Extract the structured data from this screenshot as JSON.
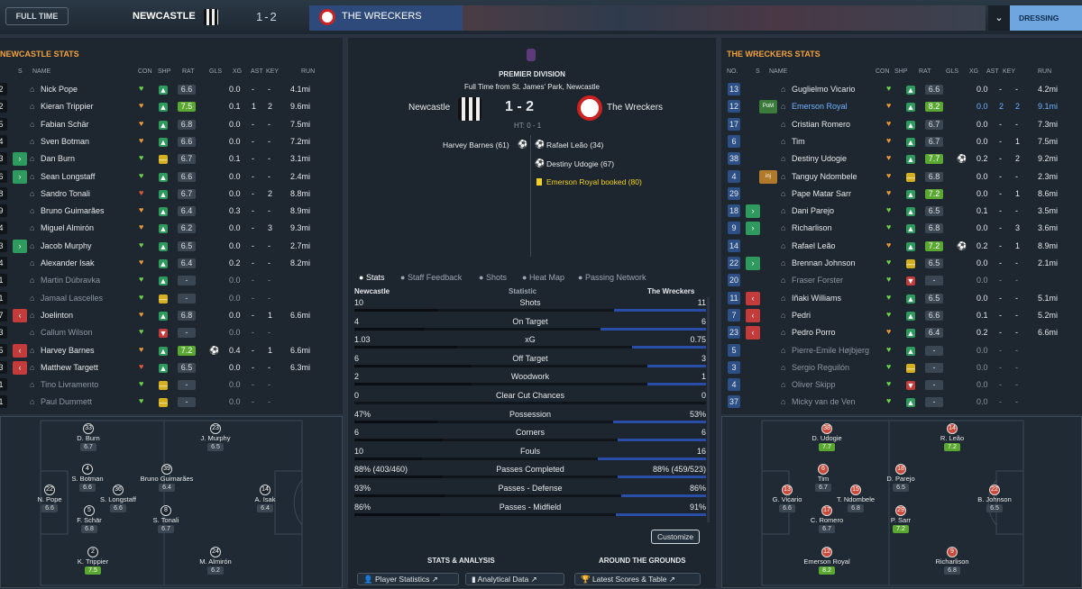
{
  "header": {
    "status": "FULL TIME",
    "home": "NEWCASTLE",
    "score": "1-2",
    "away": "THE WRECKERS",
    "dressing": "DRESSING ROOM"
  },
  "home_stats": {
    "title": "NEWCASTLE STATS",
    "cols": [
      "S",
      "NAME",
      "CON",
      "SHP",
      "RAT",
      "GLS",
      "XG",
      "AST",
      "KEY",
      "RUN"
    ],
    "rows": [
      {
        "no": "2",
        "name": "Nick Pope",
        "con": "g",
        "shp": "g",
        "rat": "6.6",
        "gls": "",
        "xg": "0.0",
        "ast": "-",
        "key": "-",
        "run": "4.1mi",
        "sub": ""
      },
      {
        "no": "2",
        "name": "Kieran Trippier",
        "con": "o",
        "shp": "g",
        "rat": "7.5",
        "gls": "",
        "xg": "0.1",
        "ast": "1",
        "key": "2",
        "run": "9.6mi",
        "sub": "",
        "hi": true
      },
      {
        "no": "5",
        "name": "Fabian Schär",
        "con": "o",
        "shp": "g",
        "rat": "6.8",
        "gls": "",
        "xg": "0.0",
        "ast": "-",
        "key": "-",
        "run": "7.5mi",
        "sub": ""
      },
      {
        "no": "4",
        "name": "Sven Botman",
        "con": "o",
        "shp": "g",
        "rat": "6.6",
        "gls": "",
        "xg": "0.0",
        "ast": "-",
        "key": "-",
        "run": "7.2mi",
        "sub": ""
      },
      {
        "no": "3",
        "name": "Dan Burn",
        "con": "g",
        "shp": "y",
        "rat": "6.7",
        "gls": "",
        "xg": "0.1",
        "ast": "-",
        "key": "-",
        "run": "3.1mi",
        "sub": "in"
      },
      {
        "no": "6",
        "name": "Sean Longstaff",
        "con": "g",
        "shp": "g",
        "rat": "6.6",
        "gls": "",
        "xg": "0.0",
        "ast": "-",
        "key": "-",
        "run": "2.4mi",
        "sub": "in"
      },
      {
        "no": "8",
        "name": "Sandro Tonali",
        "con": "r",
        "shp": "g",
        "rat": "6.7",
        "gls": "",
        "xg": "0.0",
        "ast": "-",
        "key": "2",
        "run": "8.8mi",
        "sub": ""
      },
      {
        "no": "9",
        "name": "Bruno Guimarães",
        "con": "o",
        "shp": "g",
        "rat": "6.4",
        "gls": "",
        "xg": "0.3",
        "ast": "-",
        "key": "-",
        "run": "8.9mi",
        "sub": ""
      },
      {
        "no": "4",
        "name": "Miguel Almirón",
        "con": "o",
        "shp": "g",
        "rat": "6.2",
        "gls": "",
        "xg": "0.0",
        "ast": "-",
        "key": "3",
        "run": "9.3mi",
        "sub": ""
      },
      {
        "no": "3",
        "name": "Jacob Murphy",
        "con": "g",
        "shp": "g",
        "rat": "6.5",
        "gls": "",
        "xg": "0.0",
        "ast": "-",
        "key": "-",
        "run": "2.7mi",
        "sub": "in"
      },
      {
        "no": "4",
        "name": "Alexander Isak",
        "con": "o",
        "shp": "g",
        "rat": "6.4",
        "gls": "",
        "xg": "0.2",
        "ast": "-",
        "key": "-",
        "run": "8.2mi",
        "sub": ""
      },
      {
        "no": "1",
        "name": "Martin Dúbravka",
        "con": "g",
        "shp": "g",
        "rat": "-",
        "gls": "",
        "xg": "0.0",
        "ast": "-",
        "key": "-",
        "run": "",
        "sub": "",
        "dim": true
      },
      {
        "no": "1",
        "name": "Jamaal Lascelles",
        "con": "g",
        "shp": "y",
        "rat": "-",
        "gls": "",
        "xg": "0.0",
        "ast": "-",
        "key": "-",
        "run": "",
        "sub": "",
        "dim": true
      },
      {
        "no": "7",
        "name": "Joelinton",
        "con": "o",
        "shp": "g",
        "rat": "6.8",
        "gls": "",
        "xg": "0.0",
        "ast": "-",
        "key": "1",
        "run": "6.6mi",
        "sub": "out"
      },
      {
        "no": "3",
        "name": "Callum Wilson",
        "con": "g",
        "shp": "r",
        "rat": "-",
        "gls": "",
        "xg": "0.0",
        "ast": "-",
        "key": "-",
        "run": "",
        "sub": "",
        "dim": true
      },
      {
        "no": "5",
        "name": "Harvey Barnes",
        "con": "o",
        "shp": "g",
        "rat": "7.2",
        "gls": "⚽",
        "xg": "0.4",
        "ast": "-",
        "key": "1",
        "run": "6.6mi",
        "sub": "out",
        "hi": true
      },
      {
        "no": "3",
        "name": "Matthew Targett",
        "con": "r",
        "shp": "g",
        "rat": "6.5",
        "gls": "",
        "xg": "0.0",
        "ast": "-",
        "key": "-",
        "run": "6.3mi",
        "sub": "out"
      },
      {
        "no": "1",
        "name": "Tino Livramento",
        "con": "g",
        "shp": "y",
        "rat": "-",
        "gls": "",
        "xg": "0.0",
        "ast": "-",
        "key": "-",
        "run": "",
        "sub": "",
        "dim": true
      },
      {
        "no": "1",
        "name": "Paul Dummett",
        "con": "g",
        "shp": "y",
        "rat": "-",
        "gls": "",
        "xg": "0.0",
        "ast": "-",
        "key": "-",
        "run": "",
        "sub": "",
        "dim": true
      }
    ]
  },
  "away_stats": {
    "title": "THE WRECKERS STATS",
    "cols": [
      "NO.",
      "S",
      "NAME",
      "CON",
      "SHP",
      "RAT",
      "GLS",
      "XG",
      "AST",
      "KEY",
      "RUN"
    ],
    "rows": [
      {
        "no": "13",
        "name": "Guglielmo Vicario",
        "con": "g",
        "shp": "g",
        "rat": "6.6",
        "gls": "",
        "xg": "0.0",
        "ast": "-",
        "key": "-",
        "run": "4.2mi",
        "sub": ""
      },
      {
        "no": "12",
        "name": "Emerson Royal",
        "con": "o",
        "shp": "g",
        "rat": "8.2",
        "gls": "",
        "xg": "0.0",
        "ast": "2",
        "key": "2",
        "run": "9.1mi",
        "sub": "POM",
        "hi": true,
        "hl": true
      },
      {
        "no": "17",
        "name": "Cristian Romero",
        "con": "o",
        "shp": "g",
        "rat": "6.7",
        "gls": "",
        "xg": "0.0",
        "ast": "-",
        "key": "-",
        "run": "7.3mi",
        "sub": ""
      },
      {
        "no": "6",
        "name": "Tim",
        "con": "o",
        "shp": "g",
        "rat": "6.7",
        "gls": "",
        "xg": "0.0",
        "ast": "-",
        "key": "1",
        "run": "7.5mi",
        "sub": ""
      },
      {
        "no": "38",
        "name": "Destiny Udogie",
        "con": "o",
        "shp": "g",
        "rat": "7.7",
        "gls": "⚽",
        "xg": "0.2",
        "ast": "-",
        "key": "2",
        "run": "9.2mi",
        "sub": "",
        "hi": true
      },
      {
        "no": "4",
        "name": "Tanguy Ndombele",
        "con": "o",
        "shp": "y",
        "rat": "6.8",
        "gls": "",
        "xg": "0.0",
        "ast": "-",
        "key": "-",
        "run": "2.3mi",
        "sub": "inj"
      },
      {
        "no": "29",
        "name": "Pape Matar Sarr",
        "con": "o",
        "shp": "g",
        "rat": "7.2",
        "gls": "",
        "xg": "0.0",
        "ast": "-",
        "key": "1",
        "run": "8.6mi",
        "sub": "",
        "hi": true
      },
      {
        "no": "18",
        "name": "Dani Parejo",
        "con": "g",
        "shp": "g",
        "rat": "6.5",
        "gls": "",
        "xg": "0.1",
        "ast": "-",
        "key": "-",
        "run": "3.5mi",
        "sub": "in"
      },
      {
        "no": "9",
        "name": "Richarlison",
        "con": "g",
        "shp": "g",
        "rat": "6.8",
        "gls": "",
        "xg": "0.0",
        "ast": "-",
        "key": "3",
        "run": "3.6mi",
        "sub": "in"
      },
      {
        "no": "14",
        "name": "Rafael Leão",
        "con": "o",
        "shp": "g",
        "rat": "7.2",
        "gls": "⚽",
        "xg": "0.2",
        "ast": "-",
        "key": "1",
        "run": "8.9mi",
        "sub": "",
        "hi": true
      },
      {
        "no": "22",
        "name": "Brennan Johnson",
        "con": "g",
        "shp": "y",
        "rat": "6.5",
        "gls": "",
        "xg": "0.0",
        "ast": "-",
        "key": "-",
        "run": "2.1mi",
        "sub": "in"
      },
      {
        "no": "20",
        "name": "Fraser Forster",
        "con": "g",
        "shp": "r",
        "rat": "-",
        "gls": "",
        "xg": "0.0",
        "ast": "-",
        "key": "-",
        "run": "",
        "sub": "",
        "dim": true
      },
      {
        "no": "11",
        "name": "Iñaki Williams",
        "con": "g",
        "shp": "g",
        "rat": "6.5",
        "gls": "",
        "xg": "0.0",
        "ast": "-",
        "key": "-",
        "run": "5.1mi",
        "sub": "out"
      },
      {
        "no": "7",
        "name": "Pedri",
        "con": "g",
        "shp": "g",
        "rat": "6.6",
        "gls": "",
        "xg": "0.1",
        "ast": "-",
        "key": "-",
        "run": "5.2mi",
        "sub": "out"
      },
      {
        "no": "23",
        "name": "Pedro Porro",
        "con": "o",
        "shp": "g",
        "rat": "6.4",
        "gls": "",
        "xg": "0.2",
        "ast": "-",
        "key": "-",
        "run": "6.6mi",
        "sub": "out"
      },
      {
        "no": "5",
        "name": "Pierre-Emile Højbjerg",
        "con": "g",
        "shp": "g",
        "rat": "-",
        "gls": "",
        "xg": "0.0",
        "ast": "-",
        "key": "-",
        "run": "",
        "sub": "",
        "dim": true
      },
      {
        "no": "3",
        "name": "Sergio Reguilón",
        "con": "g",
        "shp": "y",
        "rat": "-",
        "gls": "",
        "xg": "0.0",
        "ast": "-",
        "key": "-",
        "run": "",
        "sub": "",
        "dim": true
      },
      {
        "no": "4",
        "name": "Oliver Skipp",
        "con": "g",
        "shp": "r",
        "rat": "-",
        "gls": "",
        "xg": "0.0",
        "ast": "-",
        "key": "-",
        "run": "",
        "sub": "",
        "dim": true
      },
      {
        "no": "37",
        "name": "Micky van de Ven",
        "con": "g",
        "shp": "g",
        "rat": "-",
        "gls": "",
        "xg": "0.0",
        "ast": "-",
        "key": "-",
        "run": "",
        "sub": "",
        "dim": true
      }
    ]
  },
  "match": {
    "competition": "PREMIER DIVISION",
    "venue": "Full Time from St. James' Park, Newcastle",
    "home": "Newcastle",
    "away": "The Wreckers",
    "score": "1 - 2",
    "ht": "HT: 0 - 1",
    "home_events": [
      "Harvey Barnes (61)"
    ],
    "away_events": [
      "Rafael Leão (34)",
      "Destiny Udogie (67)",
      "Emerson Royal booked (80)"
    ]
  },
  "tabs": [
    "Stats",
    "Staff Feedback",
    "Shots",
    "Heat Map",
    "Passing Network"
  ],
  "stats_header": {
    "home": "Newcastle",
    "mid": "Statistic",
    "away": "The Wreckers"
  },
  "stats": [
    {
      "h": "10",
      "label": "Shots",
      "a": "11",
      "hv": 10,
      "av": 11
    },
    {
      "h": "4",
      "label": "On Target",
      "a": "6",
      "hv": 4,
      "av": 6
    },
    {
      "h": "1.03",
      "label": "xG",
      "a": "0.75",
      "hv": 1.03,
      "av": 0.75
    },
    {
      "h": "6",
      "label": "Off Target",
      "a": "3",
      "hv": 6,
      "av": 3
    },
    {
      "h": "2",
      "label": "Woodwork",
      "a": "1",
      "hv": 2,
      "av": 1
    },
    {
      "h": "0",
      "label": "Clear Cut Chances",
      "a": "0",
      "hv": 0,
      "av": 0
    },
    {
      "h": "47%",
      "label": "Possession",
      "a": "53%",
      "hv": 47,
      "av": 53
    },
    {
      "h": "6",
      "label": "Corners",
      "a": "6",
      "hv": 6,
      "av": 6
    },
    {
      "h": "10",
      "label": "Fouls",
      "a": "16",
      "hv": 10,
      "av": 16
    },
    {
      "h": "88% (403/460)",
      "label": "Passes Completed",
      "a": "88% (459/523)",
      "hv": 88,
      "av": 88
    },
    {
      "h": "93%",
      "label": "Passes - Defense",
      "a": "86%",
      "hv": 93,
      "av": 86
    },
    {
      "h": "86%",
      "label": "Passes - Midfield",
      "a": "91%",
      "hv": 86,
      "av": 91
    }
  ],
  "customize": "Customize",
  "footer": {
    "left_title": "STATS & ANALYSIS",
    "right_title": "AROUND THE GROUNDS",
    "b1": "Player Statistics",
    "b2": "Analytical Data",
    "b3": "Latest Scores & Table"
  },
  "home_pitch": [
    {
      "n": "33",
      "name": "D. Burn",
      "r": "6.7"
    },
    {
      "n": "23",
      "name": "J. Murphy",
      "r": "6.5"
    },
    {
      "n": "4",
      "name": "S. Botman",
      "r": "6.6"
    },
    {
      "n": "36",
      "name": "S. Longstaff",
      "r": "6.6"
    },
    {
      "n": "39",
      "name": "Bruno Guimarães",
      "r": "6.4"
    },
    {
      "n": "14",
      "name": "A. Isak",
      "r": "6.4"
    },
    {
      "n": "22",
      "name": "N. Pope",
      "r": "6.6"
    },
    {
      "n": "5",
      "name": "F. Schär",
      "r": "6.8"
    },
    {
      "n": "8",
      "name": "S. Tonali",
      "r": "6.7"
    },
    {
      "n": "2",
      "name": "K. Trippier",
      "r": "7.5",
      "hi": true
    },
    {
      "n": "24",
      "name": "M. Almirón",
      "r": "6.2"
    }
  ],
  "away_pitch": [
    {
      "n": "38",
      "name": "D. Udogie",
      "r": "7.7",
      "hi": true
    },
    {
      "n": "14",
      "name": "R. Leão",
      "r": "7.2",
      "hi": true
    },
    {
      "n": "6",
      "name": "Tim",
      "r": "6.7"
    },
    {
      "n": "18",
      "name": "D. Parejo",
      "r": "6.5"
    },
    {
      "n": "13",
      "name": "G. Vicario",
      "r": "6.6"
    },
    {
      "n": "15",
      "name": "T. Ndombele",
      "r": "6.8"
    },
    {
      "n": "22",
      "name": "B. Johnson",
      "r": "6.5"
    },
    {
      "n": "17",
      "name": "C. Romero",
      "r": "6.7"
    },
    {
      "n": "29",
      "name": "P. Sarr",
      "r": "7.2",
      "hi": true
    },
    {
      "n": "12",
      "name": "Emerson Royal",
      "r": "8.2",
      "hi": true
    },
    {
      "n": "9",
      "name": "Richarlison",
      "r": "6.8"
    }
  ]
}
